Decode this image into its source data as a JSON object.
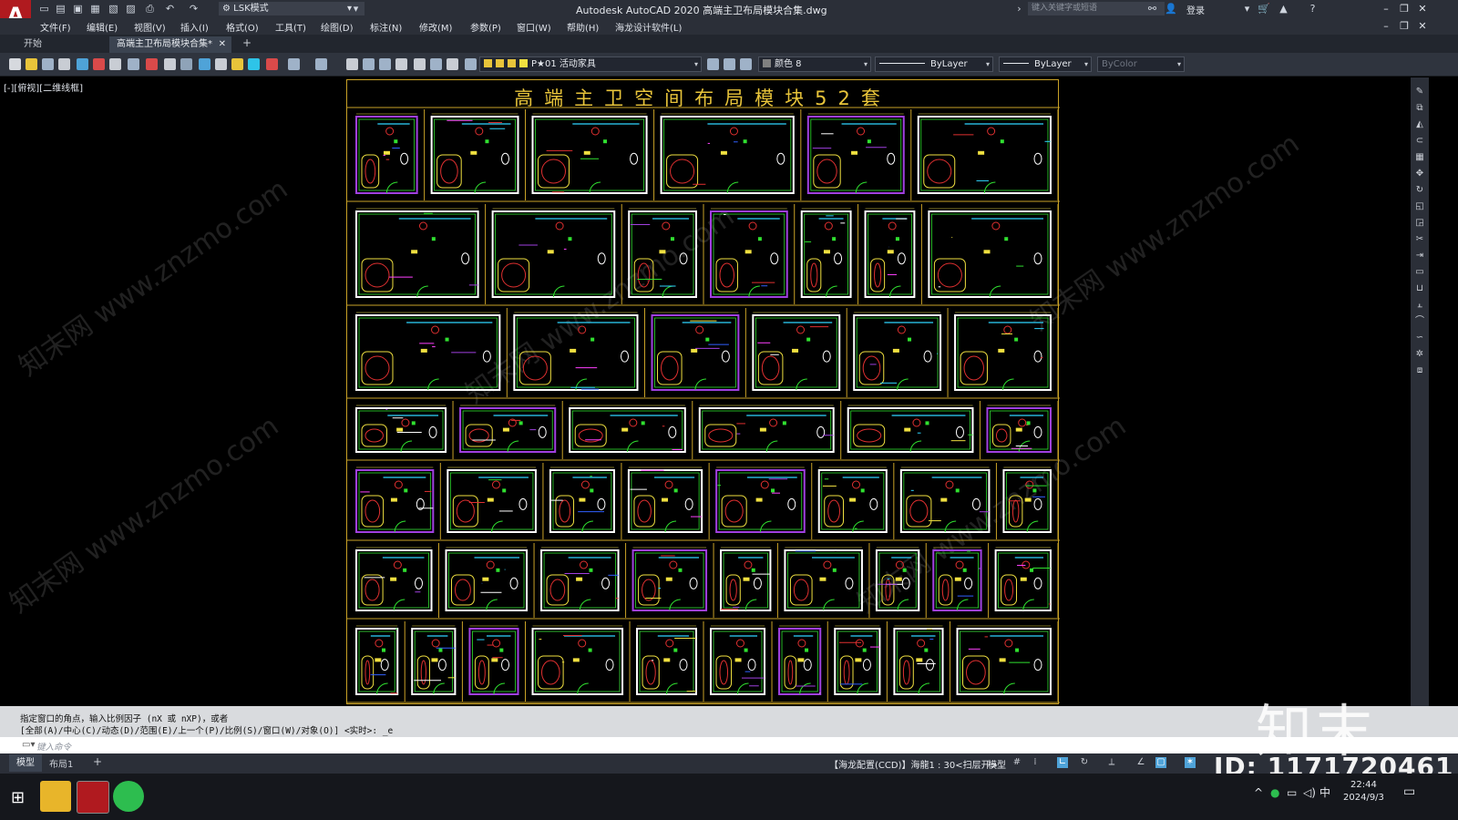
{
  "titlebar": {
    "app_logo": "A",
    "workspace": "LSK模式",
    "title": "Autodesk AutoCAD 2020    高端主卫布局模块合集.dwg",
    "search_placeholder": "键入关键字或短语",
    "login": "登录"
  },
  "menu": [
    "文件(F)",
    "编辑(E)",
    "视图(V)",
    "插入(I)",
    "格式(O)",
    "工具(T)",
    "绘图(D)",
    "标注(N)",
    "修改(M)",
    "参数(P)",
    "窗口(W)",
    "帮助(H)",
    "海龙设计软件(L)"
  ],
  "tabs": {
    "start": "开始",
    "document": "高端主卫布局模块合集*",
    "close": "✕",
    "add": "+"
  },
  "toolbar": {
    "layer": "P★01 活动家具",
    "color": "颜色 8",
    "linetype": "ByLayer",
    "lineweight": "ByLayer",
    "plotstyle": "ByColor"
  },
  "viewport": {
    "label": "[-][俯视][二维线框]",
    "sheet_title": "高端主卫空间布局模块52套",
    "watermark": "知末网 www.znzmo.com"
  },
  "command": {
    "line1": "指定窗口的角点，输入比例因子 (nX 或 nXP)，或者",
    "line2": "[全部(A)/中心(C)/动态(D)/范围(E)/上一个(P)/比例(S)/窗口(W)/对象(O)] <实时>: _e",
    "placeholder": "键入命令"
  },
  "status": {
    "model_tab": "模型",
    "layout_tab": "布局1",
    "add": "+",
    "config": "【海龙配置(CCD)】海龍1 : 30<扫层开>",
    "model": "模型",
    "id": "ID: 1171720461"
  },
  "taskbar": {
    "time": "22:44",
    "date": "2024/9/3",
    "ime": "中"
  },
  "brand": {
    "logo_text": "知末"
  },
  "colors": {
    "title_yellow": "#e8c43a",
    "frame_gold": "#c9a227",
    "autocad_red": "#b01a1f"
  }
}
